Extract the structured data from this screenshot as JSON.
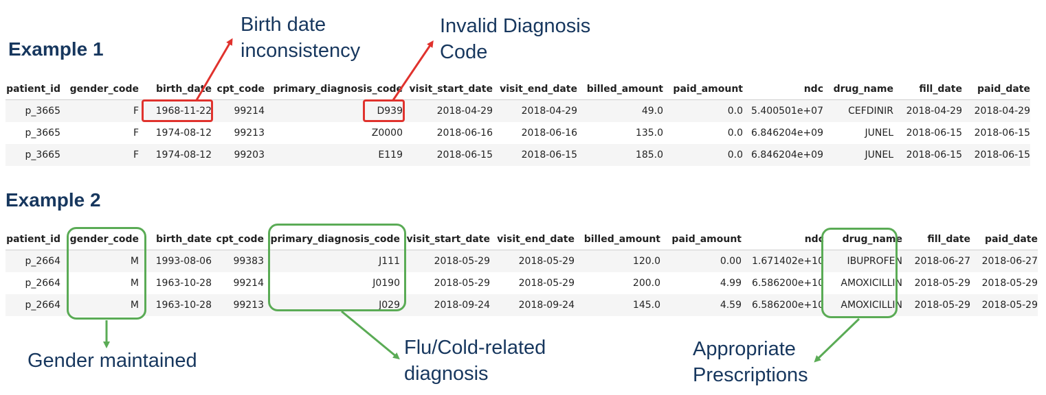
{
  "example1": {
    "title": "Example 1",
    "columns": [
      "patient_id",
      "gender_code",
      "birth_date",
      "cpt_code",
      "primary_diagnosis_code",
      "visit_start_date",
      "visit_end_date",
      "billed_amount",
      "paid_amount",
      "ndc",
      "drug_name",
      "fill_date",
      "paid_date"
    ],
    "rows": [
      [
        "p_3665",
        "F",
        "1968-11-22",
        "99214",
        "D939",
        "2018-04-29",
        "2018-04-29",
        "49.0",
        "0.0",
        "5.400501e+07",
        "CEFDINIR",
        "2018-04-29",
        "2018-04-29"
      ],
      [
        "p_3665",
        "F",
        "1974-08-12",
        "99213",
        "Z0000",
        "2018-06-16",
        "2018-06-16",
        "135.0",
        "0.0",
        "6.846204e+09",
        "JUNEL",
        "2018-06-15",
        "2018-06-15"
      ],
      [
        "p_3665",
        "F",
        "1974-08-12",
        "99203",
        "E119",
        "2018-06-15",
        "2018-06-15",
        "185.0",
        "0.0",
        "6.846204e+09",
        "JUNEL",
        "2018-06-15",
        "2018-06-15"
      ]
    ]
  },
  "example2": {
    "title": "Example 2",
    "columns": [
      "patient_id",
      "gender_code",
      "birth_date",
      "cpt_code",
      "primary_diagnosis_code",
      "visit_start_date",
      "visit_end_date",
      "billed_amount",
      "paid_amount",
      "ndc",
      "drug_name",
      "fill_date",
      "paid_date"
    ],
    "rows": [
      [
        "p_2664",
        "M",
        "1993-08-06",
        "99383",
        "J111",
        "2018-05-29",
        "2018-05-29",
        "120.0",
        "0.00",
        "1.671402e+10",
        "IBUPROFEN",
        "2018-06-27",
        "2018-06-27"
      ],
      [
        "p_2664",
        "M",
        "1963-10-28",
        "99214",
        "J0190",
        "2018-05-29",
        "2018-05-29",
        "200.0",
        "4.99",
        "6.586200e+10",
        "AMOXICILLIN",
        "2018-05-29",
        "2018-05-29"
      ],
      [
        "p_2664",
        "M",
        "1963-10-28",
        "99213",
        "J029",
        "2018-09-24",
        "2018-09-24",
        "145.0",
        "4.59",
        "6.586200e+10",
        "AMOXICILLIN",
        "2018-05-29",
        "2018-05-29"
      ]
    ]
  },
  "annotations": {
    "birth_date_1": "Birth date",
    "birth_date_2": "inconsistency",
    "invalid_dx_1": "Invalid Diagnosis",
    "invalid_dx_2": "Code",
    "gender": "Gender maintained",
    "flu_1": "Flu/Cold-related",
    "flu_2": "diagnosis",
    "rx_1": "Appropriate",
    "rx_2": "Prescriptions"
  },
  "colors": {
    "heading": "#17375e",
    "issue": "#e0322d",
    "ok": "#5aab55",
    "row_stripe": "#f5f5f5"
  }
}
